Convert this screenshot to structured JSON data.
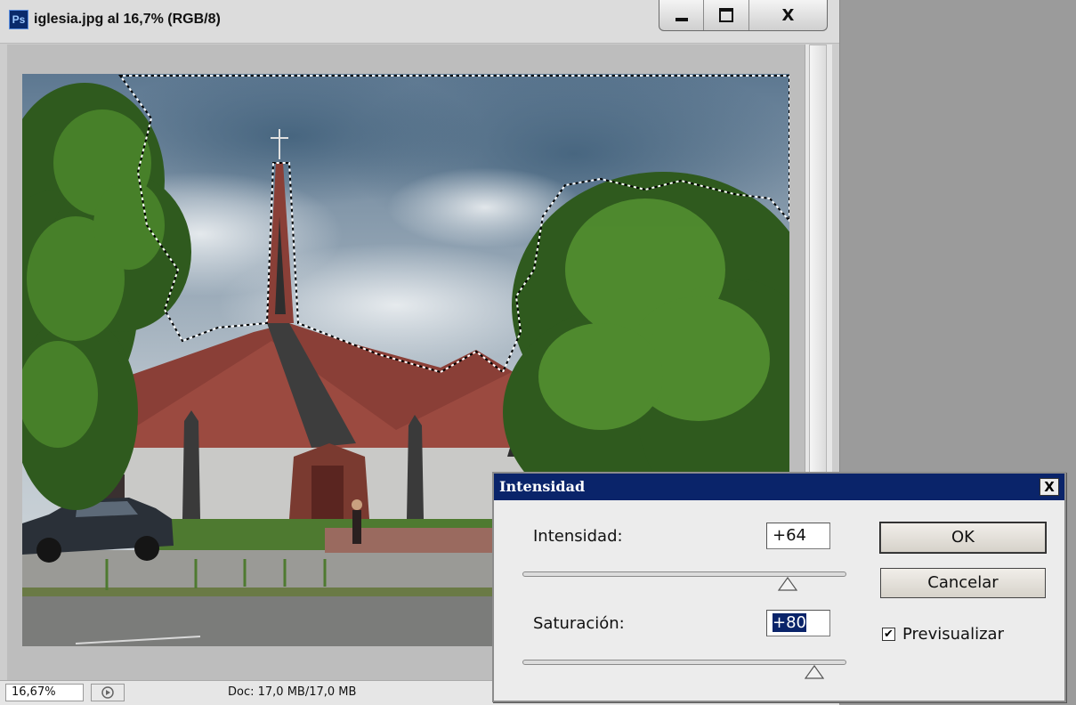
{
  "document_window": {
    "app_badge": "Ps",
    "title": "iglesia.jpg al 16,7% (RGB/8)",
    "window_controls": {
      "minimize": "minimize-icon",
      "maximize": "maximize-icon",
      "close": "X"
    }
  },
  "status_bar": {
    "zoom": "16,67%",
    "doc_size": "Doc: 17,0 MB/17,0 MB"
  },
  "dialog": {
    "title": "Intensidad",
    "close_glyph": "X",
    "intensidad_label": "Intensidad:",
    "intensidad_value": "+64",
    "intensidad_slider_fraction": 0.82,
    "saturacion_label": "Saturación:",
    "saturacion_value": "+80",
    "saturacion_slider_fraction": 0.9,
    "ok_label": "OK",
    "cancel_label": "Cancelar",
    "preview_label": "Previsualizar",
    "preview_checked": true
  },
  "colors": {
    "dialog_titlebar": "#0a246a",
    "canvas_bg": "#bdbdbd",
    "workspace_bg": "#9b9b9b"
  }
}
